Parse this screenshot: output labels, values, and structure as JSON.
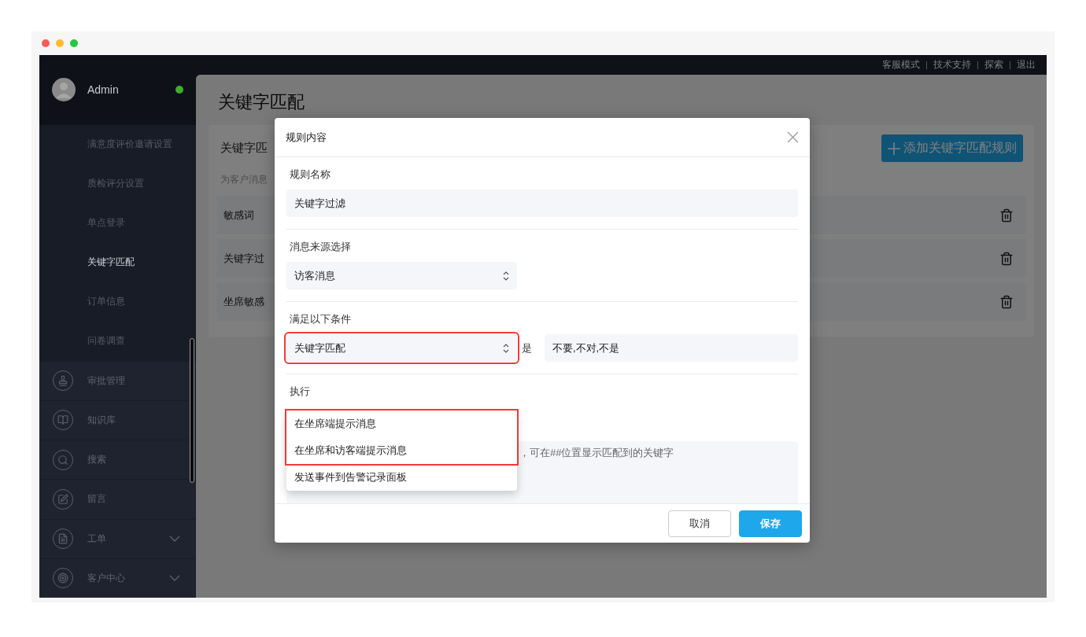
{
  "top_bar": {
    "links": [
      "客服模式",
      "技术支持",
      "探索",
      "退出"
    ]
  },
  "sidebar": {
    "user": {
      "name": "Admin",
      "online": true
    },
    "sub_items": [
      {
        "label": "满意度评价邀请设置",
        "selected": false
      },
      {
        "label": "质检评分设置",
        "selected": false
      },
      {
        "label": "单点登录",
        "selected": false
      },
      {
        "label": "关键字匹配",
        "selected": true
      },
      {
        "label": "订单信息",
        "selected": false
      },
      {
        "label": "问卷调查",
        "selected": false
      }
    ],
    "items": [
      {
        "label": "审批管理",
        "kind": "stamp",
        "expandable": false
      },
      {
        "label": "知识库",
        "kind": "book",
        "expandable": false
      },
      {
        "label": "搜索",
        "kind": "search",
        "expandable": false
      },
      {
        "label": "留言",
        "kind": "edit",
        "expandable": false
      },
      {
        "label": "工单",
        "kind": "document",
        "expandable": true
      },
      {
        "label": "客户中心",
        "kind": "target",
        "expandable": true
      }
    ]
  },
  "page": {
    "title": "关键字匹配",
    "card": {
      "title": "关键字匹",
      "subtitle": "为客户消息",
      "add_button": "添加关键字匹配规则",
      "rules": [
        "敏感词",
        "关键字过",
        "坐席敏感"
      ]
    }
  },
  "dialog": {
    "title": "规则内容",
    "name": {
      "label": "规则名称",
      "value": "关键字过滤"
    },
    "source": {
      "label": "消息来源选择",
      "value": "访客消息"
    },
    "condition": {
      "label": "满足以下条件",
      "field": "关键字匹配",
      "highlighted": true,
      "operator": "是",
      "value": "不要,不对,不是"
    },
    "action": {
      "label": "执行",
      "options": [
        {
          "label": "在坐席端提示消息",
          "highlighted": true
        },
        {
          "label": "在坐席和访客端提示消息",
          "highlighted": true
        },
        {
          "label": "发送事件到告警记录面板",
          "highlighted": false
        }
      ],
      "hint": "，可在##位置显示匹配到的关键字"
    },
    "buttons": [
      {
        "label": "取消",
        "primary": false
      },
      {
        "label": "保存",
        "primary": true
      }
    ]
  }
}
